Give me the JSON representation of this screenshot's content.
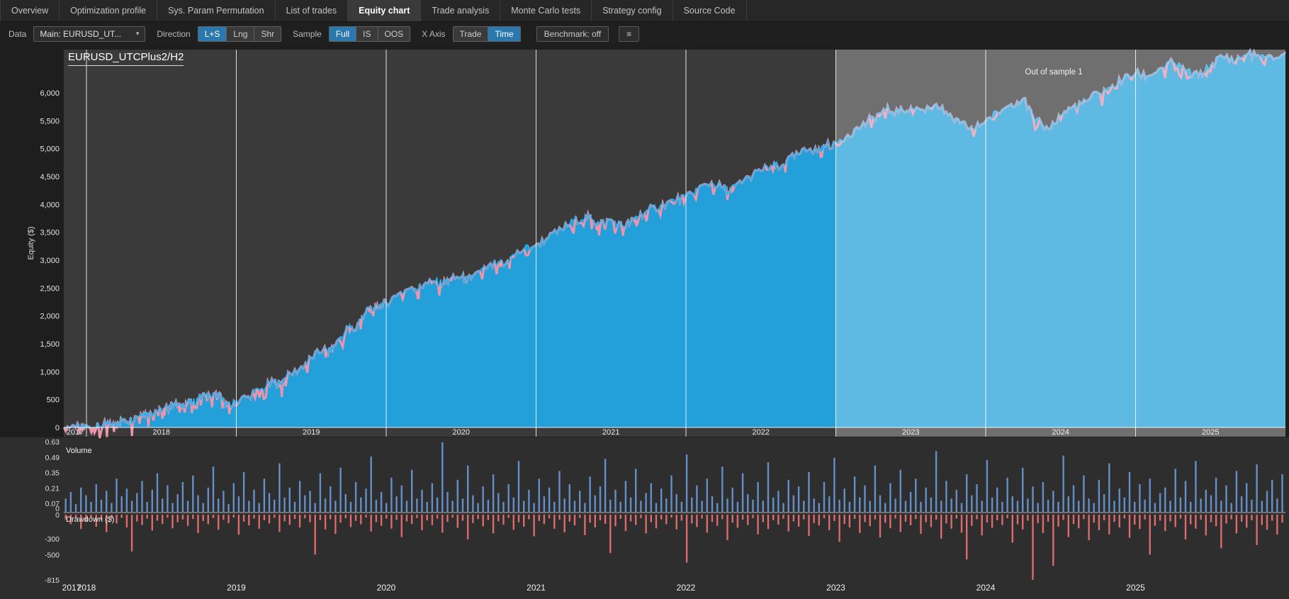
{
  "colors": {
    "accent": "#2a78ad",
    "plot_bg": "#3a3a3a",
    "band_bg": "#2e2e2e",
    "grid": "#ffffff",
    "equity_fill": "#239fd9",
    "equity_line": "#25b2f2",
    "pink": "#ee94ab",
    "volume": "#648fc8",
    "drawdown": "#dd6b6b",
    "oos_overlay": "rgba(255,255,255,0.27)"
  },
  "tabs": [
    {
      "label": "Overview",
      "active": false
    },
    {
      "label": "Optimization profile",
      "active": false
    },
    {
      "label": "Sys. Param Permutation",
      "active": false
    },
    {
      "label": "List of trades",
      "active": false
    },
    {
      "label": "Equity chart",
      "active": true
    },
    {
      "label": "Trade analysis",
      "active": false
    },
    {
      "label": "Monte Carlo tests",
      "active": false
    },
    {
      "label": "Strategy config",
      "active": false
    },
    {
      "label": "Source Code",
      "active": false
    }
  ],
  "toolbar": {
    "data_label": "Data",
    "data_select_value": "Main: EURUSD_UT...",
    "direction_label": "Direction",
    "direction_options": [
      "L+S",
      "Lng",
      "Shr"
    ],
    "direction_active": "L+S",
    "sample_label": "Sample",
    "sample_options": [
      "Full",
      "IS",
      "OOS"
    ],
    "sample_active": "Full",
    "xaxis_label": "X Axis",
    "xaxis_options": [
      "Trade",
      "Time"
    ],
    "xaxis_active": "Time",
    "benchmark_label": "Benchmark: off",
    "menu_icon": "≡"
  },
  "chart_data": [
    {
      "type": "area",
      "title": "EURUSD_UTCPlus2/H2",
      "ylabel": "Equity ($)",
      "yticks": [
        "0",
        "500",
        "1,000",
        "1,500",
        "2,000",
        "2,500",
        "3,000",
        "3,500",
        "4,000",
        "4,500",
        "5,000",
        "5,500",
        "6,000"
      ],
      "xticks": [
        2017,
        2018,
        2019,
        2020,
        2021,
        2022,
        2023,
        2024,
        2025
      ],
      "xlim": [
        2017.85,
        2026.0
      ],
      "ylim": [
        -200,
        6780
      ],
      "out_of_sample": {
        "label": "Out of sample 1",
        "start": 2023
      },
      "x": [
        2017.85,
        2017.92,
        2017.96,
        2018.0,
        2018.04,
        2018.08,
        2018.13,
        2018.17,
        2018.21,
        2018.25,
        2018.29,
        2018.33,
        2018.38,
        2018.42,
        2018.46,
        2018.5,
        2018.54,
        2018.58,
        2018.63,
        2018.67,
        2018.71,
        2018.75,
        2018.79,
        2018.83,
        2018.88,
        2018.92,
        2018.96,
        2019.0,
        2019.08,
        2019.17,
        2019.25,
        2019.29,
        2019.33,
        2019.42,
        2019.5,
        2019.58,
        2019.63,
        2019.67,
        2019.75,
        2019.79,
        2019.83,
        2019.88,
        2019.92,
        2019.96,
        2020.0,
        2020.08,
        2020.17,
        2020.21,
        2020.25,
        2020.33,
        2020.38,
        2020.42,
        2020.5,
        2020.54,
        2020.58,
        2020.67,
        2020.75,
        2020.79,
        2020.83,
        2020.92,
        2021.0,
        2021.08,
        2021.17,
        2021.25,
        2021.33,
        2021.38,
        2021.42,
        2021.5,
        2021.58,
        2021.63,
        2021.67,
        2021.75,
        2021.83,
        2021.92,
        2022.0,
        2022.08,
        2022.17,
        2022.25,
        2022.29,
        2022.33,
        2022.42,
        2022.5,
        2022.58,
        2022.63,
        2022.67,
        2022.75,
        2022.83,
        2022.88,
        2022.92,
        2023.0,
        2023.08,
        2023.17,
        2023.25,
        2023.33,
        2023.42,
        2023.5,
        2023.58,
        2023.67,
        2023.75,
        2023.83,
        2023.92,
        2024.0,
        2024.08,
        2024.17,
        2024.25,
        2024.33,
        2024.42,
        2024.5,
        2024.58,
        2024.67,
        2024.75,
        2024.83,
        2024.92,
        2025.0,
        2025.08,
        2025.17,
        2025.25,
        2025.33,
        2025.42,
        2025.5,
        2025.58,
        2025.67,
        2025.75,
        2025.83,
        2025.92,
        2026.0
      ],
      "y": [
        0,
        30,
        -20,
        10,
        -40,
        20,
        60,
        30,
        90,
        150,
        120,
        200,
        260,
        230,
        310,
        280,
        350,
        420,
        390,
        460,
        430,
        520,
        580,
        545,
        600,
        430,
        380,
        480,
        560,
        700,
        820,
        780,
        900,
        1050,
        1250,
        1400,
        1350,
        1550,
        1800,
        1750,
        1950,
        2150,
        2100,
        2200,
        2230,
        2400,
        2520,
        2480,
        2560,
        2620,
        2580,
        2650,
        2700,
        2640,
        2720,
        2850,
        2960,
        2920,
        3050,
        3200,
        3280,
        3400,
        3550,
        3700,
        3790,
        3720,
        3650,
        3730,
        3600,
        3680,
        3780,
        3900,
        3980,
        4080,
        4140,
        4280,
        4400,
        4300,
        4220,
        4350,
        4500,
        4600,
        4700,
        4650,
        4780,
        4900,
        5000,
        4950,
        5060,
        5100,
        5250,
        5400,
        5550,
        5700,
        5650,
        5750,
        5700,
        5800,
        5600,
        5450,
        5350,
        5500,
        5650,
        5800,
        5900,
        5500,
        5350,
        5600,
        5750,
        5850,
        6000,
        6100,
        6250,
        6350,
        6300,
        6450,
        6550,
        6400,
        6300,
        6500,
        6650,
        6600,
        6700,
        6650,
        6600,
        6730
      ]
    },
    {
      "type": "bar",
      "label": "Volume",
      "yticks": [
        "0.63",
        "0.49",
        "0.35",
        "0.21",
        "0.07",
        "0"
      ],
      "ymax": 0.63,
      "values": [
        0.12,
        0.18,
        0.07,
        0.22,
        0.15,
        0.09,
        0.25,
        0.11,
        0.19,
        0.08,
        0.3,
        0.14,
        0.21,
        0.1,
        0.17,
        0.28,
        0.09,
        0.2,
        0.35,
        0.12,
        0.24,
        0.08,
        0.16,
        0.27,
        0.1,
        0.33,
        0.15,
        0.08,
        0.22,
        0.41,
        0.12,
        0.19,
        0.07,
        0.26,
        0.14,
        0.36,
        0.1,
        0.2,
        0.08,
        0.3,
        0.17,
        0.11,
        0.44,
        0.13,
        0.22,
        0.09,
        0.28,
        0.15,
        0.19,
        0.08,
        0.35,
        0.12,
        0.23,
        0.1,
        0.4,
        0.16,
        0.09,
        0.27,
        0.13,
        0.21,
        0.5,
        0.11,
        0.18,
        0.08,
        0.31,
        0.14,
        0.24,
        0.1,
        0.38,
        0.12,
        0.2,
        0.09,
        0.26,
        0.13,
        0.63,
        0.18,
        0.1,
        0.29,
        0.12,
        0.42,
        0.15,
        0.08,
        0.23,
        0.11,
        0.34,
        0.17,
        0.09,
        0.25,
        0.13,
        0.46,
        0.1,
        0.2,
        0.08,
        0.3,
        0.14,
        0.22,
        0.09,
        0.37,
        0.12,
        0.25,
        0.1,
        0.19,
        0.08,
        0.32,
        0.15,
        0.23,
        0.48,
        0.11,
        0.2,
        0.09,
        0.28,
        0.13,
        0.39,
        0.1,
        0.17,
        0.26,
        0.08,
        0.21,
        0.12,
        0.33,
        0.16,
        0.09,
        0.52,
        0.13,
        0.24,
        0.1,
        0.3,
        0.14,
        0.08,
        0.41,
        0.12,
        0.22,
        0.09,
        0.35,
        0.16,
        0.11,
        0.27,
        0.1,
        0.45,
        0.13,
        0.19,
        0.08,
        0.29,
        0.15,
        0.23,
        0.1,
        0.36,
        0.12,
        0.08,
        0.27,
        0.14,
        0.49,
        0.11,
        0.21,
        0.09,
        0.32,
        0.13,
        0.24,
        0.1,
        0.42,
        0.15,
        0.08,
        0.26,
        0.12,
        0.38,
        0.1,
        0.18,
        0.3,
        0.09,
        0.22,
        0.13,
        0.55,
        0.1,
        0.28,
        0.12,
        0.2,
        0.08,
        0.34,
        0.15,
        0.25,
        0.1,
        0.47,
        0.13,
        0.22,
        0.09,
        0.31,
        0.14,
        0.1,
        0.4,
        0.12,
        0.23,
        0.08,
        0.27,
        0.11,
        0.19,
        0.09,
        0.51,
        0.14,
        0.24,
        0.1,
        0.33,
        0.12,
        0.08,
        0.29,
        0.16,
        0.44,
        0.1,
        0.21,
        0.13,
        0.36,
        0.09,
        0.25,
        0.11,
        0.3,
        0.08,
        0.17,
        0.22,
        0.1,
        0.39,
        0.13,
        0.28,
        0.09,
        0.46,
        0.12,
        0.2,
        0.15,
        0.31,
        0.1,
        0.24,
        0.08,
        0.37,
        0.14,
        0.26,
        0.11,
        0.43,
        0.1,
        0.19,
        0.29,
        0.12,
        0.34
      ]
    },
    {
      "type": "bar",
      "label": "Drawdown ($)",
      "yticks": [
        "0",
        "-300",
        "-500",
        "-815"
      ],
      "ymin": -815,
      "values": [
        -60,
        -120,
        -45,
        -180,
        -90,
        -35,
        -150,
        -70,
        -220,
        -55,
        -110,
        -40,
        -160,
        -460,
        -85,
        -130,
        -50,
        -200,
        -75,
        -115,
        -38,
        -170,
        -95,
        -60,
        -140,
        -52,
        -230,
        -80,
        -120,
        -42,
        -190,
        -65,
        -105,
        -36,
        -250,
        -88,
        -135,
        -48,
        -175,
        -70,
        -110,
        -40,
        -215,
        -82,
        -128,
        -55,
        -160,
        -45,
        -95,
        -500,
        -70,
        -185,
        -58,
        -240,
        -100,
        -44,
        -155,
        -78,
        -120,
        -36,
        -210,
        -92,
        -140,
        -50,
        -175,
        -65,
        -280,
        -85,
        -115,
        -42,
        -195,
        -72,
        -130,
        -48,
        -225,
        -90,
        -38,
        -165,
        -75,
        -310,
        -105,
        -55,
        -145,
        -68,
        -235,
        -84,
        -125,
        -40,
        -190,
        -95,
        -150,
        -58,
        -270,
        -80,
        -118,
        -46,
        -175,
        -62,
        -220,
        -88,
        -135,
        -42,
        -255,
        -98,
        -160,
        -70,
        -115,
        -480,
        -145,
        -52,
        -205,
        -85,
        -130,
        -44,
        -235,
        -95,
        -170,
        -60,
        -120,
        -38,
        -185,
        -75,
        -600,
        -110,
        -155,
        -48,
        -225,
        -90,
        -140,
        -55,
        -320,
        -100,
        -165,
        -62,
        -130,
        -42,
        -245,
        -95,
        -180,
        -70,
        -125,
        -50,
        -210,
        -85,
        -150,
        -58,
        -265,
        -105,
        -135,
        -45,
        -195,
        -80,
        -340,
        -115,
        -160,
        -52,
        -230,
        -92,
        -145,
        -60,
        -285,
        -100,
        -170,
        -48,
        -215,
        -88,
        -132,
        -55,
        -240,
        -95,
        -155,
        -62,
        -300,
        -110,
        -175,
        -50,
        -225,
        -560,
        -140,
        -58,
        -260,
        -98,
        -165,
        -70,
        -130,
        -45,
        -350,
        -120,
        -185,
        -75,
        -815,
        -105,
        -230,
        -88,
        -640,
        -150,
        -65,
        -280,
        -115,
        -170,
        -55,
        -320,
        -100,
        -195,
        -72,
        -245,
        -90,
        -160,
        -48,
        -290,
        -125,
        -180,
        -60,
        -500,
        -140,
        -75,
        -205,
        -85,
        -155,
        -50,
        -310,
        -120,
        -175,
        -62,
        -260,
        -95,
        -145,
        -420,
        -110,
        -58,
        -235,
        -88,
        -165,
        -70,
        -380,
        -130,
        -190,
        -75,
        -250,
        -100
      ]
    }
  ]
}
